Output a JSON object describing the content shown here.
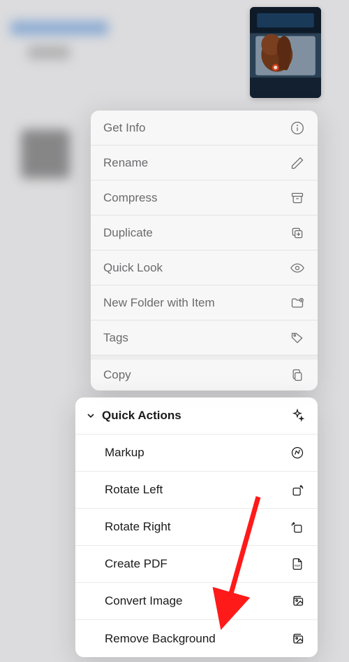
{
  "thumbnail": {
    "description": "dog-in-car-window"
  },
  "menu_upper": {
    "items": [
      {
        "label": "Get Info",
        "icon": "info-icon"
      },
      {
        "label": "Rename",
        "icon": "pencil-icon"
      },
      {
        "label": "Compress",
        "icon": "archive-icon"
      },
      {
        "label": "Duplicate",
        "icon": "duplicate-icon"
      },
      {
        "label": "Quick Look",
        "icon": "eye-icon"
      },
      {
        "label": "New Folder with Item",
        "icon": "folder-add-icon"
      },
      {
        "label": "Tags",
        "icon": "tag-icon"
      },
      {
        "label": "Copy",
        "icon": "copy-icon"
      }
    ]
  },
  "menu_lower": {
    "header": "Quick Actions",
    "header_icon": "sparkles-icon",
    "items": [
      {
        "label": "Markup",
        "icon": "markup-icon"
      },
      {
        "label": "Rotate Left",
        "icon": "rotate-left-icon"
      },
      {
        "label": "Rotate Right",
        "icon": "rotate-right-icon"
      },
      {
        "label": "Create PDF",
        "icon": "pdf-icon"
      },
      {
        "label": "Convert Image",
        "icon": "convert-image-icon"
      },
      {
        "label": "Remove Background",
        "icon": "image-icon"
      }
    ]
  }
}
